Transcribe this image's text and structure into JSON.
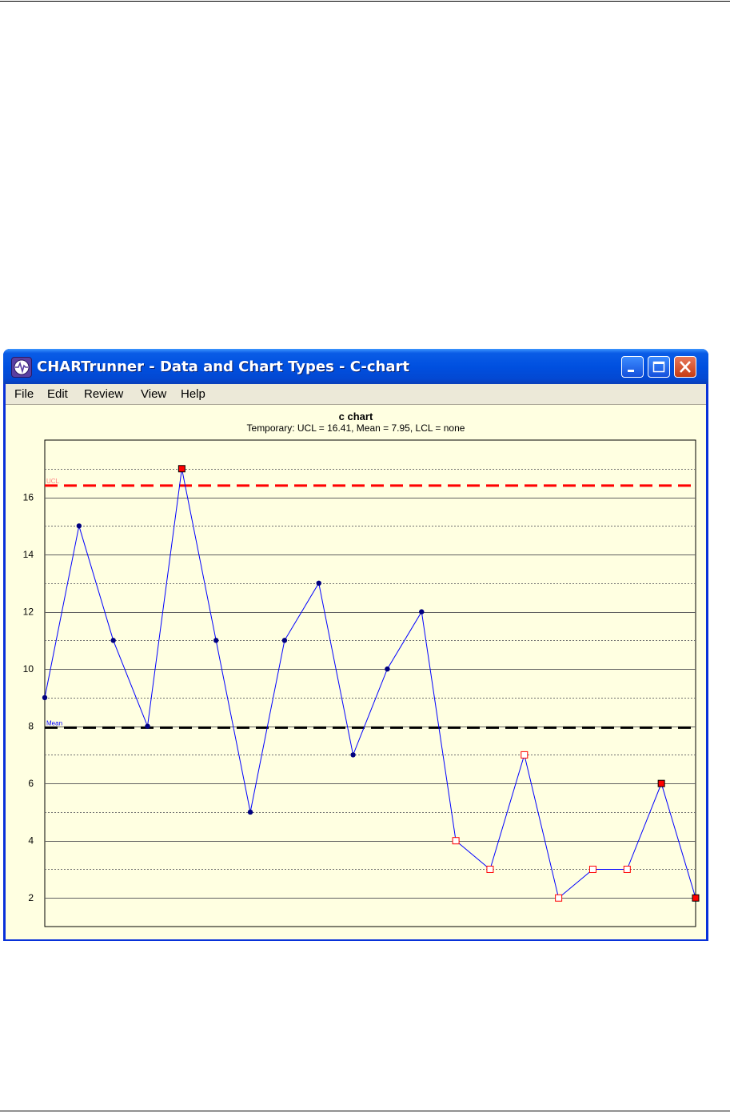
{
  "window": {
    "title": "CHARTrunner - Data and Chart Types - C-chart",
    "icon": "chartrunner-app-icon",
    "controls": [
      "minimize-icon",
      "maximize-icon",
      "close-icon"
    ]
  },
  "menu": {
    "items": [
      {
        "label": "File"
      },
      {
        "label": "Edit"
      },
      {
        "label": "Review"
      },
      {
        "label": "View"
      },
      {
        "label": "Help"
      }
    ]
  },
  "colors": {
    "series": "#0000ff",
    "ucl": "#ff0000",
    "mean": "#000000",
    "in_control_point": "#00007f",
    "flagged_point": "#ff0000"
  },
  "chart_data": {
    "type": "line",
    "title": "c chart",
    "subtitle": "Temporary: UCL = 16.41, Mean = 7.95, LCL = none",
    "ylim": [
      1,
      18
    ],
    "yticks": [
      2,
      4,
      6,
      8,
      10,
      12,
      14,
      16
    ],
    "grid": true,
    "series": [
      {
        "values": [
          9,
          15,
          11,
          8,
          17,
          11,
          5,
          11,
          13,
          7,
          10,
          12,
          4,
          3,
          7,
          2,
          3,
          3,
          6,
          2
        ],
        "markers": [
          "dot",
          "dot",
          "dot",
          "dot",
          "flag-filled",
          "dot",
          "dot",
          "dot",
          "dot",
          "dot",
          "dot",
          "dot",
          "flag-hollow",
          "flag-hollow",
          "flag-hollow",
          "flag-hollow",
          "flag-hollow",
          "flag-hollow",
          "flag-filled",
          "flag-filled"
        ]
      }
    ],
    "control_lines": [
      {
        "label": "UCL",
        "value": 16.41,
        "color": "#ff0000"
      },
      {
        "label": "Mean",
        "value": 7.95,
        "color": "#000000"
      }
    ]
  }
}
